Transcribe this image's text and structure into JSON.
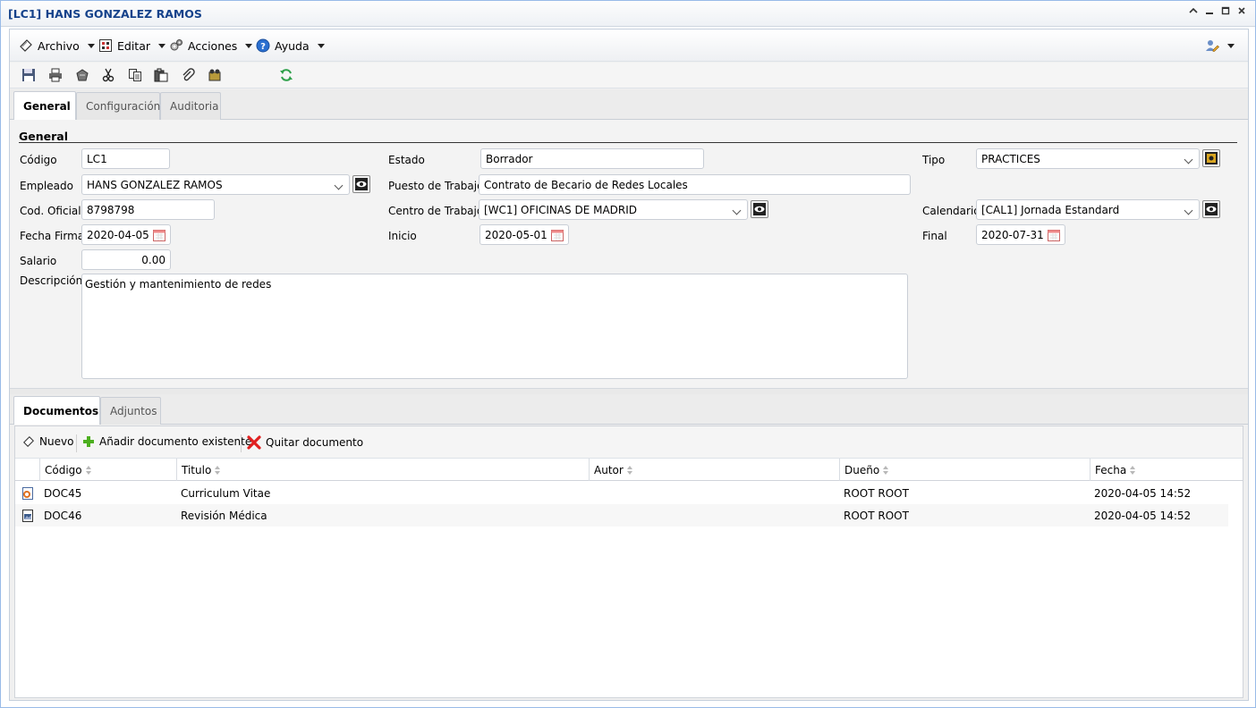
{
  "window": {
    "title": "[LC1] HANS GONZALEZ RAMOS"
  },
  "menubar": {
    "archivo": "Archivo",
    "editar": "Editar",
    "acciones": "Acciones",
    "ayuda": "Ayuda"
  },
  "tabs": {
    "general": "General",
    "configuracion": "Configuración",
    "auditoria": "Auditoria"
  },
  "form": {
    "section_title": "General",
    "codigo_label": "Código",
    "codigo_value": "LC1",
    "empleado_label": "Empleado",
    "empleado_value": "HANS GONZALEZ RAMOS",
    "cod_oficial_label": "Cod. Oficial",
    "cod_oficial_value": "8798798",
    "fecha_firma_label": "Fecha Firma",
    "fecha_firma_value": "2020-04-05",
    "salario_label": "Salario",
    "salario_value": "0.00",
    "descripcion_label": "Descripción",
    "descripcion_value": "Gestión y mantenimiento de redes",
    "estado_label": "Estado",
    "estado_value": "Borrador",
    "puesto_label": "Puesto de Trabajo",
    "puesto_value": "Contrato de Becario de Redes Locales",
    "centro_label": "Centro de Trabajo",
    "centro_value": "[WC1] OFICINAS DE MADRID",
    "inicio_label": "Inicio",
    "inicio_value": "2020-05-01",
    "tipo_label": "Tipo",
    "tipo_value": "PRACTICES",
    "calendario_label": "Calendario",
    "calendario_value": "[CAL1] Jornada Estandard",
    "final_label": "Final",
    "final_value": "2020-07-31"
  },
  "bottom_tabs": {
    "documentos": "Documentos",
    "adjuntos": "Adjuntos"
  },
  "documents": {
    "toolbar": {
      "nuevo": "Nuevo",
      "anadir": "Añadir documento existente",
      "quitar": "Quitar documento"
    },
    "columns": [
      "Código",
      "Titulo",
      "Autor",
      "Dueño",
      "Fecha"
    ],
    "rows": [
      {
        "codigo": "DOC45",
        "titulo": "Curriculum Vitae",
        "autor": "",
        "dueno": "ROOT ROOT",
        "fecha": "2020-04-05 14:52",
        "icon": "office-document-icon"
      },
      {
        "codigo": "DOC46",
        "titulo": "Revisión Médica",
        "autor": "",
        "dueno": "ROOT ROOT",
        "fecha": "2020-04-05 14:52",
        "icon": "image-document-icon"
      }
    ]
  },
  "colors": {
    "title_text": "#15428b",
    "remove_red": "#e02020",
    "add_green": "#4caf1f"
  }
}
